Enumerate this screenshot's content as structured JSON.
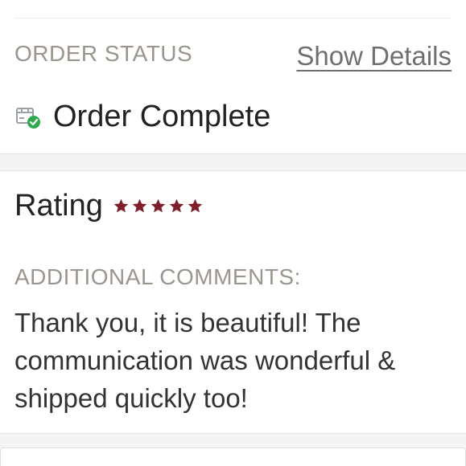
{
  "order_status": {
    "label": "ORDER STATUS",
    "show_details_label": "Show Details",
    "status_text": "Order Complete",
    "status_icon": "box-check-icon"
  },
  "review": {
    "rating_label": "Rating",
    "rating_value": 5,
    "rating_max": 5,
    "star_color": "#7f1e2b",
    "comments_label": "ADDITIONAL COMMENTS:",
    "comments_text": "Thank you, it is beautiful! The communication was wonderful & shipped quickly too!"
  },
  "colors": {
    "accent_check": "#2fa84f",
    "label_gray": "#9a958e",
    "text_dark": "#222222"
  }
}
